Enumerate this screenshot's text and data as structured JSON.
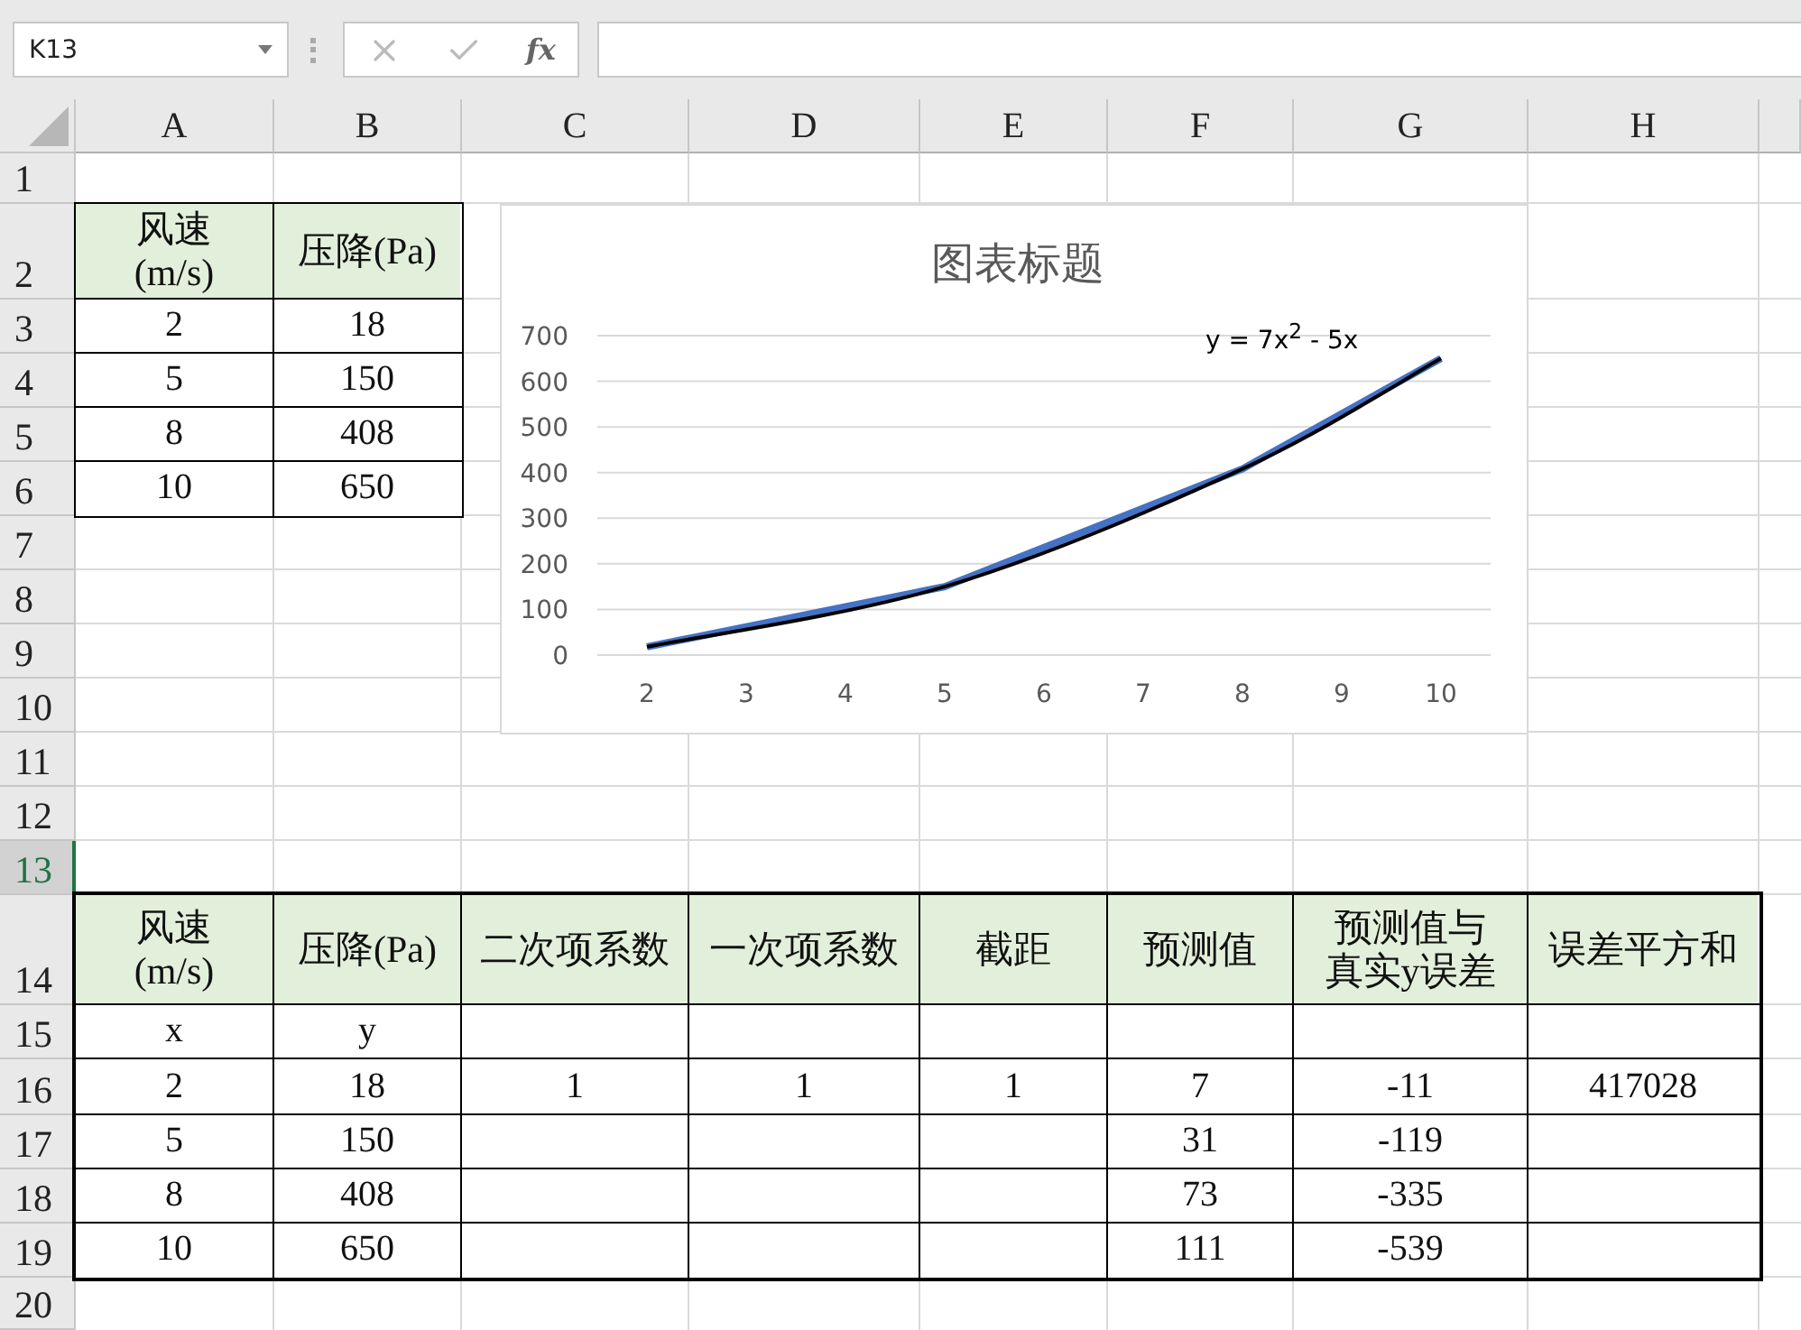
{
  "name_box": {
    "value": "K13"
  },
  "formula_bar": {
    "function_button": "fx"
  },
  "columns": [
    {
      "label": "A",
      "selected": false
    },
    {
      "label": "B",
      "selected": false
    },
    {
      "label": "C",
      "selected": false
    },
    {
      "label": "D",
      "selected": false
    },
    {
      "label": "E",
      "selected": false
    },
    {
      "label": "F",
      "selected": false
    },
    {
      "label": "G",
      "selected": false
    },
    {
      "label": "H",
      "selected": false
    }
  ],
  "rows": [
    {
      "label": "1",
      "selected": false
    },
    {
      "label": "2",
      "selected": false
    },
    {
      "label": "3",
      "selected": false
    },
    {
      "label": "4",
      "selected": false
    },
    {
      "label": "5",
      "selected": false
    },
    {
      "label": "6",
      "selected": false
    },
    {
      "label": "7",
      "selected": false
    },
    {
      "label": "8",
      "selected": false
    },
    {
      "label": "9",
      "selected": false
    },
    {
      "label": "10",
      "selected": false
    },
    {
      "label": "11",
      "selected": false
    },
    {
      "label": "12",
      "selected": false
    },
    {
      "label": "13",
      "selected": true
    },
    {
      "label": "14",
      "selected": false
    },
    {
      "label": "15",
      "selected": false
    },
    {
      "label": "16",
      "selected": false
    },
    {
      "label": "17",
      "selected": false
    },
    {
      "label": "18",
      "selected": false
    },
    {
      "label": "19",
      "selected": false
    },
    {
      "label": "20",
      "selected": false
    }
  ],
  "tables": [
    {
      "header": [
        "风速\n(m/s)",
        "压降(Pa)"
      ],
      "rows": [
        [
          "2",
          "18"
        ],
        [
          "5",
          "150"
        ],
        [
          "8",
          "408"
        ],
        [
          "10",
          "650"
        ]
      ]
    },
    {
      "header": [
        "风速\n(m/s)",
        "压降(Pa)",
        "二次项系数",
        "一次项系数",
        "截距",
        "预测值",
        "预测值与真实y误差",
        "误差平方和"
      ],
      "rows": [
        [
          "x",
          "y",
          null,
          null,
          null,
          null,
          null,
          null
        ],
        [
          "2",
          "18",
          "1",
          "1",
          "1",
          "7",
          "-11",
          "417028"
        ],
        [
          "5",
          "150",
          null,
          null,
          null,
          "31",
          "-119",
          null
        ],
        [
          "8",
          "408",
          null,
          null,
          null,
          "73",
          "-335",
          null
        ],
        [
          "10",
          "650",
          null,
          null,
          null,
          "111",
          "-539",
          null
        ]
      ]
    }
  ],
  "chart": {
    "chart_data": {
      "type": "line",
      "title": "图表标题",
      "x": [
        2,
        5,
        8,
        10
      ],
      "xlim": [
        1.5,
        10.5
      ],
      "ylim": [
        0,
        700
      ],
      "xticks": [
        2,
        3,
        4,
        5,
        6,
        7,
        8,
        9,
        10
      ],
      "yticks": [
        0,
        100,
        200,
        300,
        400,
        500,
        600,
        700
      ],
      "grid": true,
      "series": [
        {
          "color": "#4472c4",
          "values": [
            18,
            150,
            408,
            650
          ]
        },
        {
          "color": "#000000",
          "values": [
            18,
            150,
            408,
            650
          ]
        }
      ],
      "annotations": [
        "y = 7x$^{2}$ - 5x"
      ]
    }
  }
}
